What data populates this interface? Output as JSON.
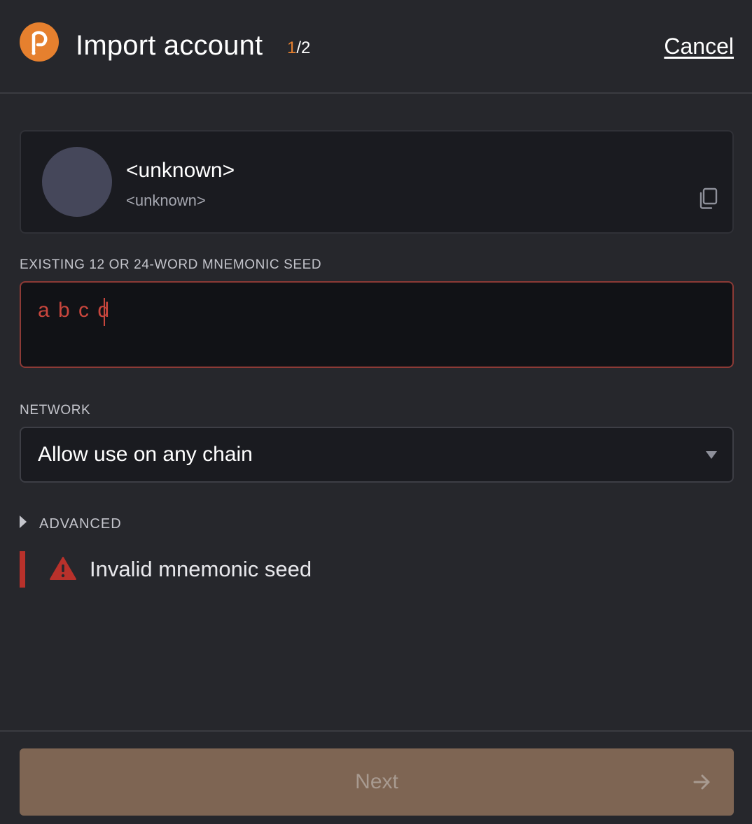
{
  "header": {
    "title": "Import account",
    "step_current": "1",
    "step_total": "/2",
    "cancel_label": "Cancel"
  },
  "account": {
    "name": "<unknown>",
    "address": "<unknown>"
  },
  "seed": {
    "label": "EXISTING 12 OR 24-WORD MNEMONIC SEED",
    "value": "a b c d"
  },
  "network": {
    "label": "NETWORK",
    "selected": "Allow use on any chain"
  },
  "advanced": {
    "label": "ADVANCED"
  },
  "warning": {
    "text": "Invalid mnemonic seed"
  },
  "footer": {
    "next_label": "Next"
  },
  "colors": {
    "background": "#26272c",
    "accent": "#e6802e",
    "error": "#c9463d",
    "next_button": "#7e6553"
  },
  "icons": {
    "logo": "polkadot-logo-icon",
    "copy": "copy-icon",
    "warning": "warning-triangle-icon",
    "dropdown": "chevron-down-icon",
    "advanced_toggle": "caret-right-icon",
    "next_arrow": "arrow-right-icon"
  }
}
